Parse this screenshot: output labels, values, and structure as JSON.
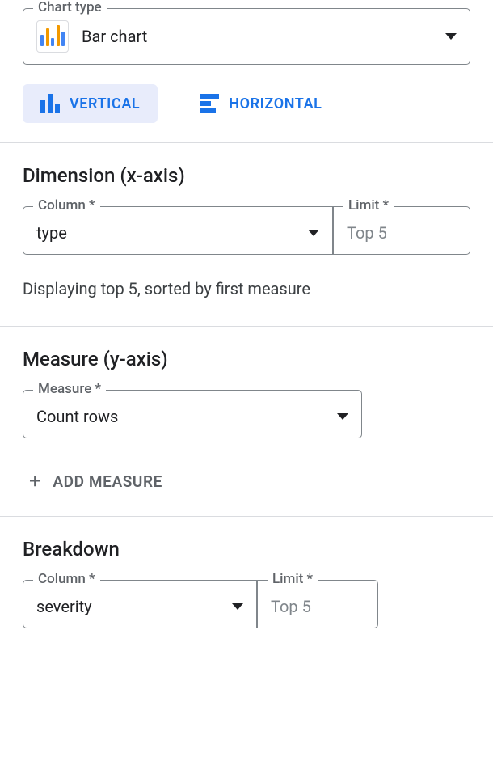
{
  "chartType": {
    "legend": "Chart type",
    "value": "Bar chart"
  },
  "orientation": {
    "vertical": "VERTICAL",
    "horizontal": "HORIZONTAL"
  },
  "dimension": {
    "title": "Dimension (x-axis)",
    "columnLabel": "Column *",
    "columnValue": "type",
    "limitLabel": "Limit *",
    "limitValue": "Top 5",
    "helper": "Displaying top 5, sorted by first measure"
  },
  "measure": {
    "title": "Measure (y-axis)",
    "label": "Measure *",
    "value": "Count rows",
    "addLabel": "ADD MEASURE"
  },
  "breakdown": {
    "title": "Breakdown",
    "columnLabel": "Column *",
    "columnValue": "severity",
    "limitLabel": "Limit *",
    "limitValue": "Top 5"
  }
}
